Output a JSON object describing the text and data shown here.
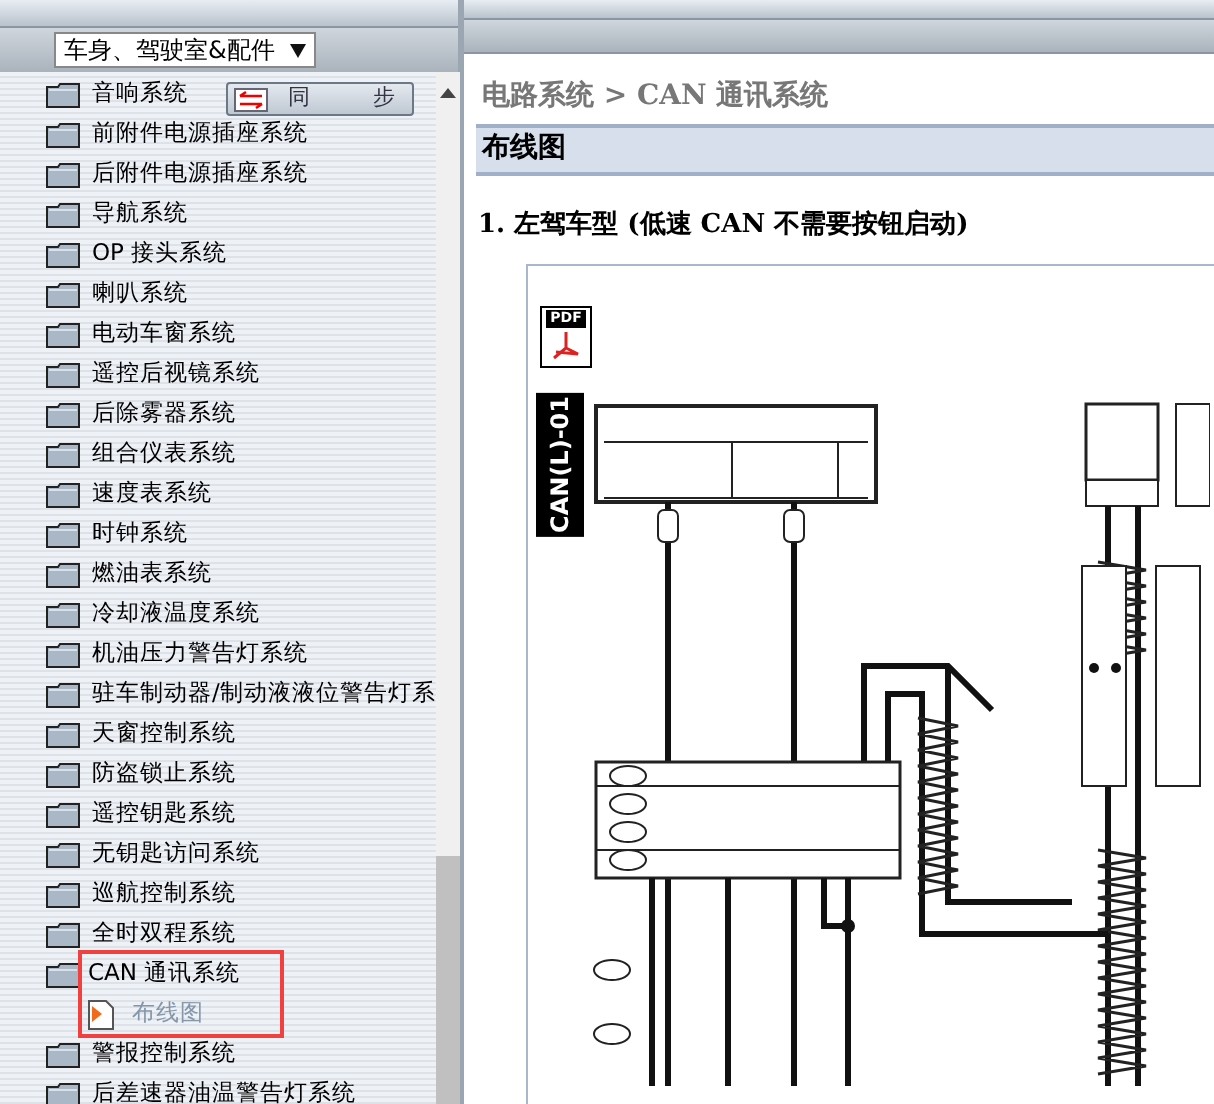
{
  "sidebar": {
    "category_select": "车身、驾驶室&配件",
    "sync_button": "同 步",
    "tree": [
      {
        "label": "音响系统"
      },
      {
        "label": "前附件电源插座系统"
      },
      {
        "label": "后附件电源插座系统"
      },
      {
        "label": "导航系统"
      },
      {
        "label": "OP 接头系统"
      },
      {
        "label": "喇叭系统"
      },
      {
        "label": "电动车窗系统"
      },
      {
        "label": "遥控后视镜系统"
      },
      {
        "label": "后除雾器系统"
      },
      {
        "label": "组合仪表系统"
      },
      {
        "label": "速度表系统"
      },
      {
        "label": "时钟系统"
      },
      {
        "label": "燃油表系统"
      },
      {
        "label": "冷却液温度系统"
      },
      {
        "label": "机油压力警告灯系统"
      },
      {
        "label": "驻车制动器/制动液液位警告灯系"
      },
      {
        "label": "天窗控制系统"
      },
      {
        "label": "防盗锁止系统"
      },
      {
        "label": "遥控钥匙系统"
      },
      {
        "label": "无钥匙访问系统"
      },
      {
        "label": "巡航控制系统"
      },
      {
        "label": "全时双程系统"
      },
      {
        "label": "CAN 通讯系统",
        "highlighted": true,
        "children": [
          {
            "label": "布线图",
            "selected": true
          }
        ]
      },
      {
        "label": "警报控制系统"
      },
      {
        "label": "后差速器油温警告灯系统"
      }
    ]
  },
  "content": {
    "breadcrumb": "电路系统 > CAN 通讯系统",
    "section_title": "布线图",
    "heading": "1. 左驾车型 (低速 CAN 不需要按钮启动)",
    "diagram": {
      "pdf_icon": "PDF",
      "label": "CAN(L)-01"
    }
  }
}
